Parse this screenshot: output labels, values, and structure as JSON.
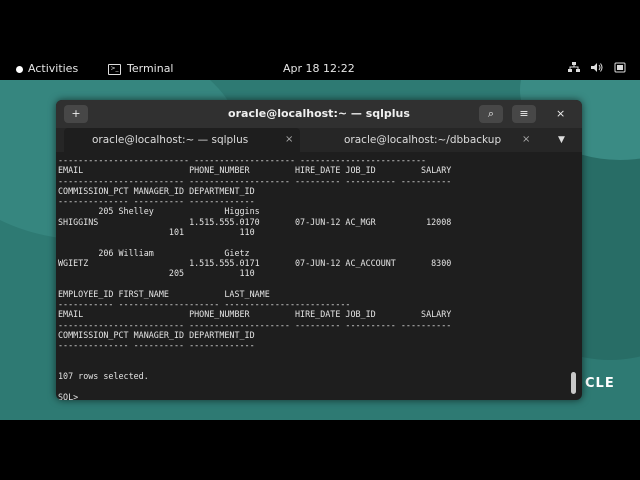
{
  "topbar": {
    "activities": "Activities",
    "app": "Terminal",
    "clock": "Apr 18  12:22"
  },
  "tray": {
    "network": "network-icon",
    "volume": "volume-icon",
    "power": "power-icon"
  },
  "desktop": {
    "logo_text": "CLE"
  },
  "window": {
    "title": "oracle@localhost:~ — sqlplus",
    "new_tab_glyph": "+",
    "search_glyph": "⌕",
    "menu_glyph": "≡",
    "close_glyph": "×"
  },
  "tabs": [
    {
      "label": "oracle@localhost:~ — sqlplus",
      "close": "×"
    },
    {
      "label": "oracle@localhost:~/dbbackup",
      "close": "×"
    }
  ],
  "tab_menu_glyph": "▼",
  "console": {
    "lines": [
      "-------------------------- -------------------- -------------------------",
      "EMAIL                     PHONE_NUMBER         HIRE_DATE JOB_ID         SALARY",
      "------------------------- -------------------- --------- ---------- ----------",
      "COMMISSION_PCT MANAGER_ID DEPARTMENT_ID",
      "-------------- ---------- -------------",
      "        205 Shelley              Higgins",
      "SHIGGINS                  1.515.555.0170       07-JUN-12 AC_MGR          12008",
      "                      101           110",
      "",
      "        206 William              Gietz",
      "WGIETZ                    1.515.555.0171       07-JUN-12 AC_ACCOUNT       8300",
      "                      205           110",
      "",
      "EMPLOYEE_ID FIRST_NAME           LAST_NAME",
      "----------- -------------------- -------------------------",
      "EMAIL                     PHONE_NUMBER         HIRE_DATE JOB_ID         SALARY",
      "------------------------- -------------------- --------- ---------- ----------",
      "COMMISSION_PCT MANAGER_ID DEPARTMENT_ID",
      "-------------- ---------- -------------",
      "",
      "",
      "107 rows selected.",
      "",
      "SQL>"
    ]
  }
}
